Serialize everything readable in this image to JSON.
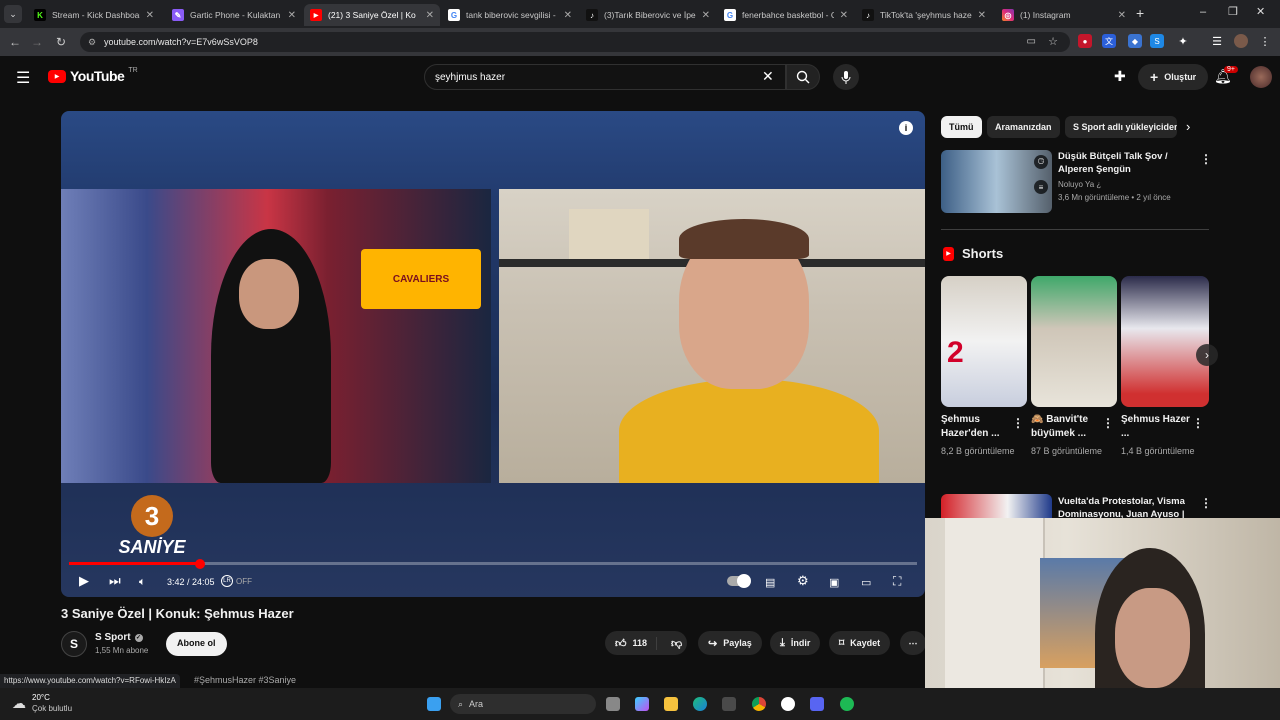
{
  "browser": {
    "tabs": [
      {
        "title": "Stream - Kick Dashboard",
        "icon": "kick-icon",
        "color": "#53fc18"
      },
      {
        "title": "Gartic Phone - Kulaktan K",
        "icon": "gartic-icon",
        "color": "#8a5cf6"
      },
      {
        "title": "(21) 3 Saniye Özel | Ko",
        "icon": "youtube-icon",
        "color": "#ff0000",
        "active": true
      },
      {
        "title": "tank biberovic sevgilisi - G",
        "icon": "google-icon",
        "color": "#ffffff"
      },
      {
        "title": "(3)Tarık Biberovic ve İpek",
        "icon": "tiktok-icon",
        "color": "#111111"
      },
      {
        "title": "fenerbahce basketbol - G",
        "icon": "google-icon",
        "color": "#ffffff"
      },
      {
        "title": "TikTok'ta 'şeyhmus hazer",
        "icon": "tiktok-icon",
        "color": "#111111"
      },
      {
        "title": "(1) Instagram",
        "icon": "instagram-icon",
        "color": "#e1306c"
      }
    ],
    "url": "youtube.com/watch?v=E7v6wSsVOP8",
    "status_url": "https://www.youtube.com/watch?v=RFowi-HkIzA"
  },
  "youtube": {
    "logo_text": "YouTube",
    "region": "TR",
    "search_query": "şeyhjmus hazer",
    "create_label": "Oluştur",
    "notification_count": "9+"
  },
  "video": {
    "title": "3 Saniye Özel | Konuk: Şehmus Hazer",
    "overlay_brand": "SANİYE",
    "overlay_number": "3",
    "time_current": "3:42",
    "time_total": "24:05",
    "time_display": "3:42 / 24:05",
    "progress": 0.154,
    "autoplay_label": "OFF",
    "channel_name": "S Sport",
    "subscribers": "1,55 Mn abone",
    "subscribe_label": "Abone ol",
    "likes": "118",
    "share_label": "Paylaş",
    "download_label": "İndir",
    "save_label": "Kaydet",
    "hashtags": "#ŞehmusHazer #3Saniye"
  },
  "sidebar": {
    "chips": [
      "Tümü",
      "Aramanızdan",
      "S Sport adlı yükleyiciden"
    ],
    "recommended": {
      "title": "Düşük Bütçeli Talk Şov / Alperen Şengün",
      "channel": "Noluyo Ya ¿",
      "meta": "3,6 Mn görüntüleme • 2 yıl önce"
    },
    "shorts_heading": "Shorts",
    "shorts": [
      {
        "title": "Şehmus Hazer'den ...",
        "views": "8,2 B görüntüleme"
      },
      {
        "title": "🙈 Banvit'te büyümek ...",
        "views": "87 B görüntüleme"
      },
      {
        "title": "Şehmus Hazer ...",
        "views": "1,4 B görüntüleme"
      }
    ],
    "next_video": {
      "title": "Vuelta'da Protestolar, Visma Dominasyonu, Juan Ayuso | ..."
    }
  },
  "taskbar": {
    "weather_temp": "20°C",
    "weather_desc": "Çok bulutlu",
    "search_label": "Ara"
  }
}
